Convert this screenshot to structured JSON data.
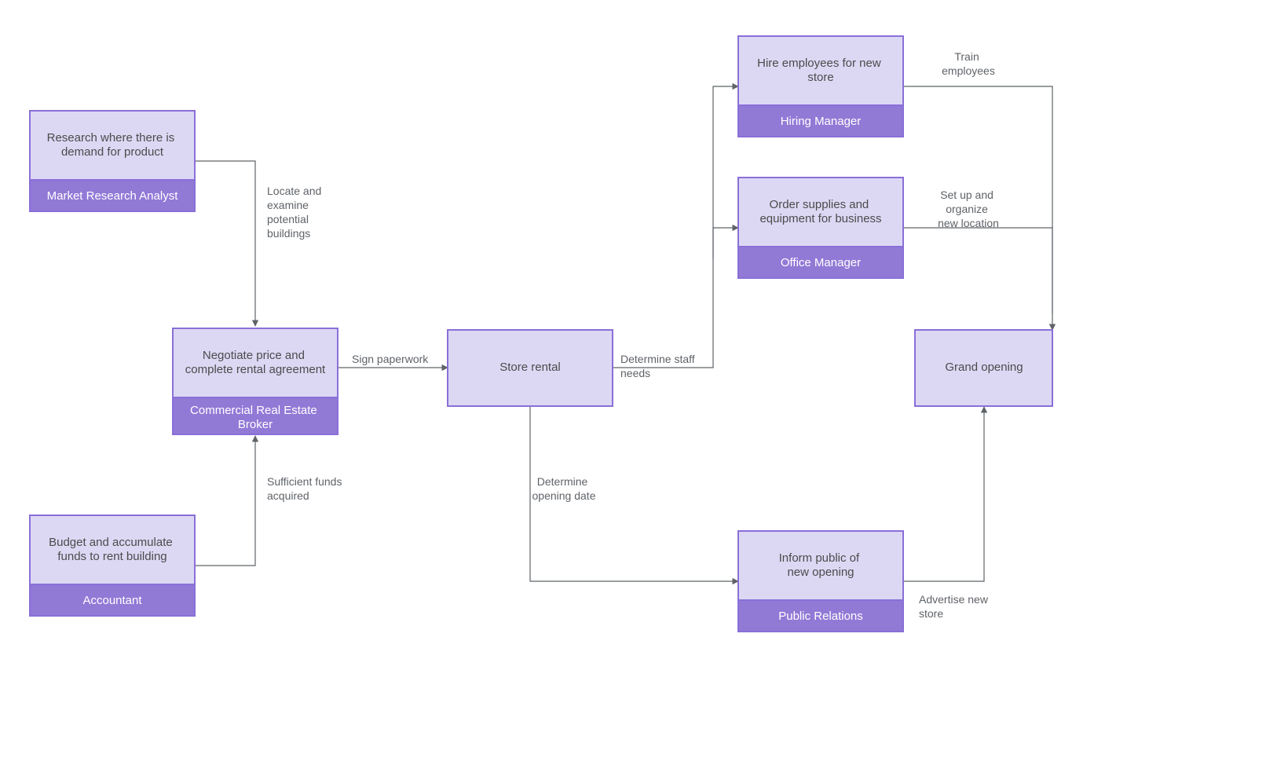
{
  "nodes": {
    "market_research": {
      "task": "Research where there is demand for product",
      "role": "Market Research Analyst"
    },
    "accountant": {
      "task": "Budget and accumulate funds to rent building",
      "role": "Accountant"
    },
    "broker": {
      "task": "Negotiate price and complete rental agreement",
      "role": "Commercial Real Estate Broker"
    },
    "store_rental": {
      "task": "Store rental"
    },
    "hiring": {
      "task": "Hire employees for new store",
      "role": "Hiring Manager"
    },
    "office_mgr": {
      "task": "Order supplies and equipment for business",
      "role": "Office Manager"
    },
    "pr": {
      "task": "Inform public of new opening",
      "role": "Public Relations"
    },
    "grand": {
      "task": "Grand opening"
    }
  },
  "edges": {
    "locate": [
      "Locate and",
      "examine",
      "potential",
      "buildings"
    ],
    "funds": [
      "Sufficient funds",
      "acquired"
    ],
    "sign": "Sign paperwork",
    "staff": [
      "Determine staff",
      "needs"
    ],
    "date": [
      "Determine",
      "opening date"
    ],
    "train": [
      "Train",
      "employees"
    ],
    "setup": [
      "Set up and",
      "organize",
      "new location"
    ],
    "advertise": [
      "Advertise new",
      "store"
    ]
  }
}
